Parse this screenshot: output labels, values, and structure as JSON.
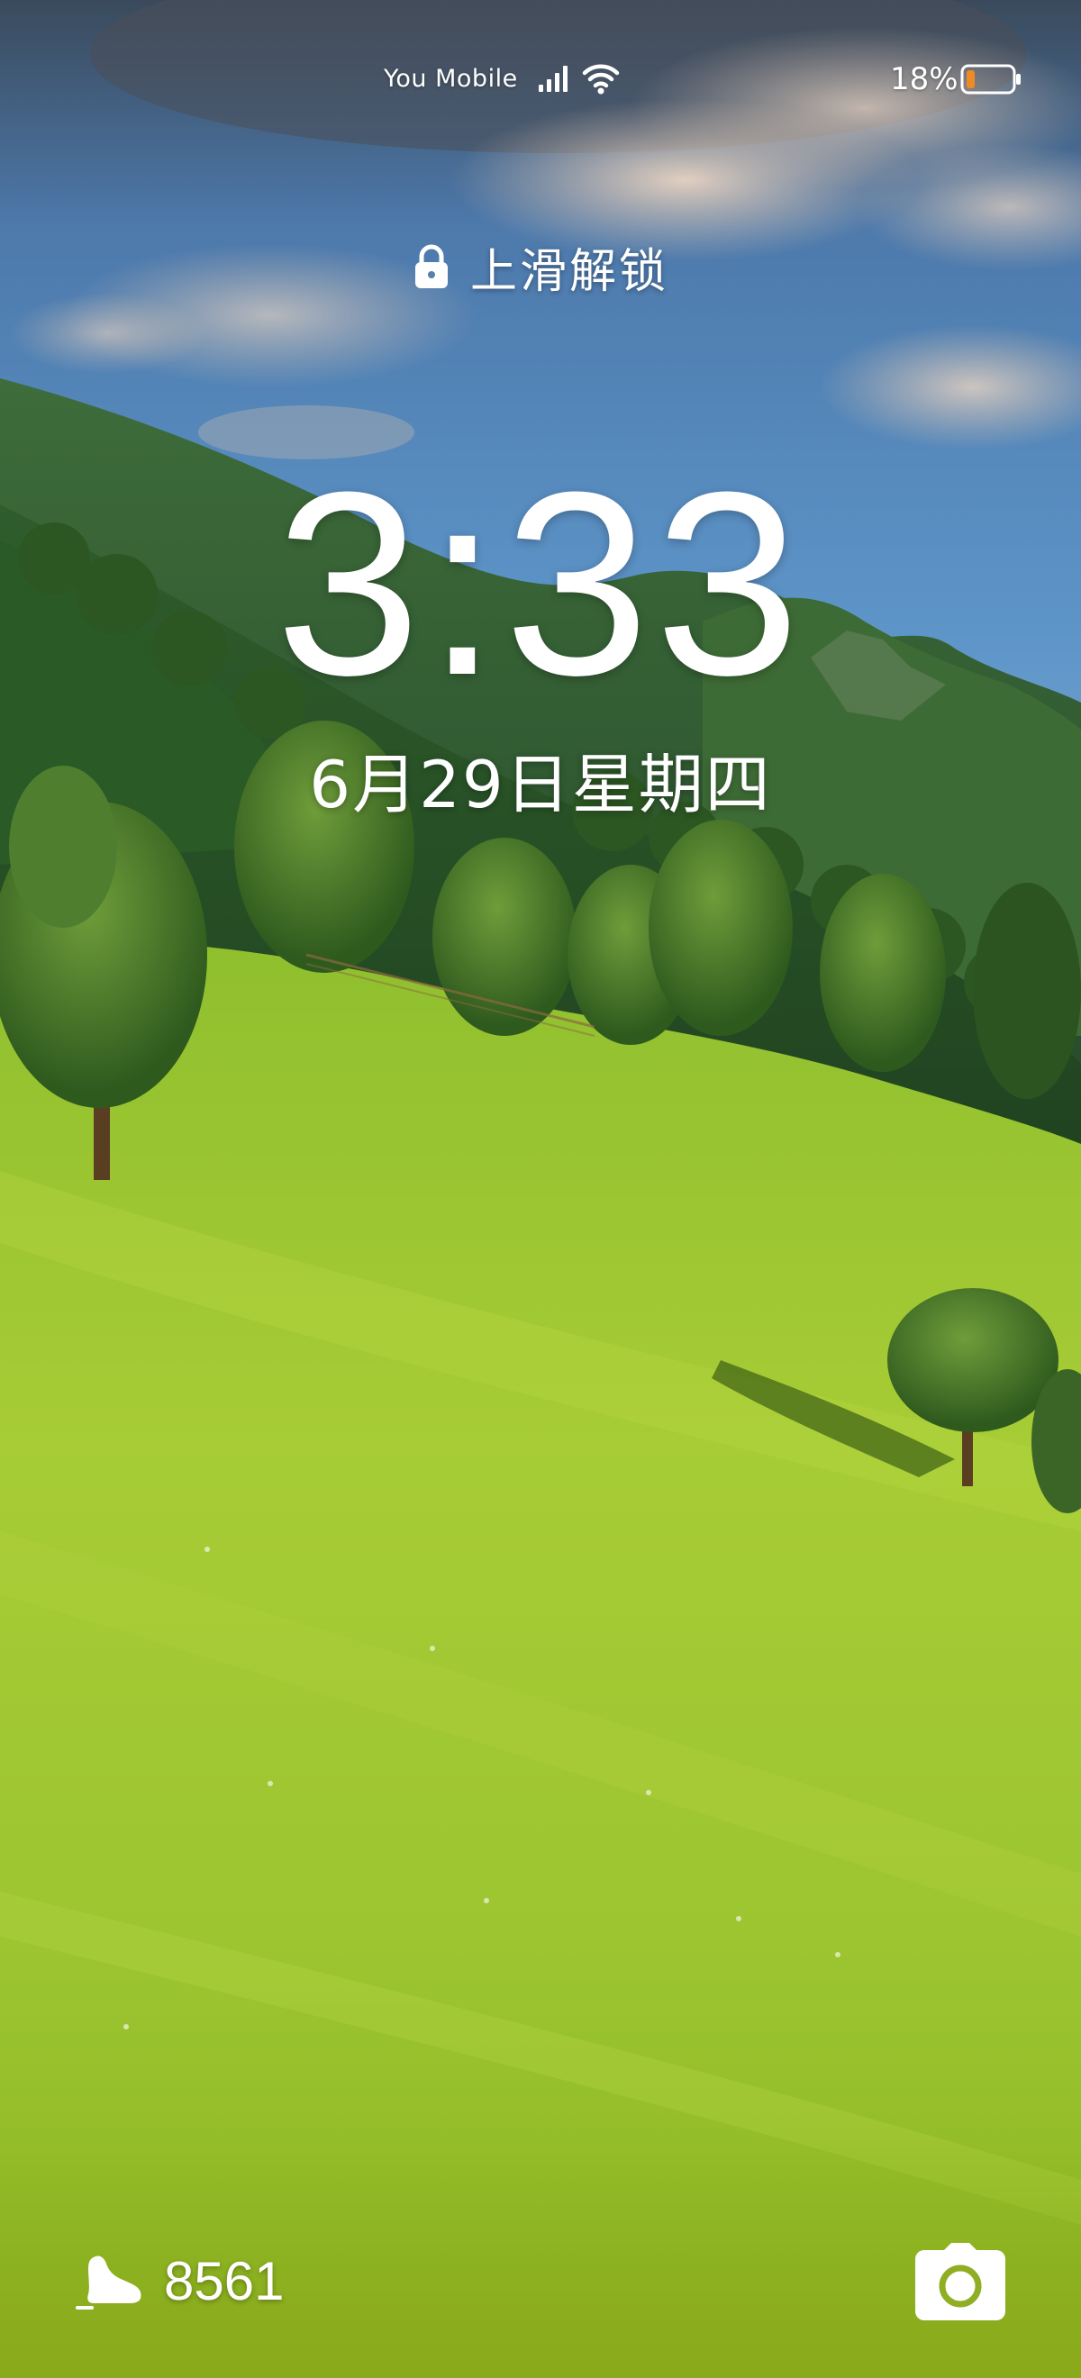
{
  "status_bar": {
    "carrier": "You Mobile",
    "signal_icon": "cellular-signal-icon",
    "wifi_icon": "wifi-icon",
    "battery_percent": "18%",
    "battery_level": 0.18,
    "battery_icon": "battery-low-icon",
    "battery_color": "#f08a24"
  },
  "lock_screen": {
    "lock_icon": "lock-icon",
    "unlock_hint": "上滑解锁",
    "time": "3:33",
    "date": "6月29日星期四"
  },
  "widgets": {
    "steps_icon": "shoe-icon",
    "step_count": "8561",
    "camera_icon": "camera-icon"
  },
  "wallpaper": {
    "description_colors": {
      "sky": "#4f82b8",
      "mountains": "#2f5a2a",
      "meadow": "#9cc42f"
    }
  }
}
